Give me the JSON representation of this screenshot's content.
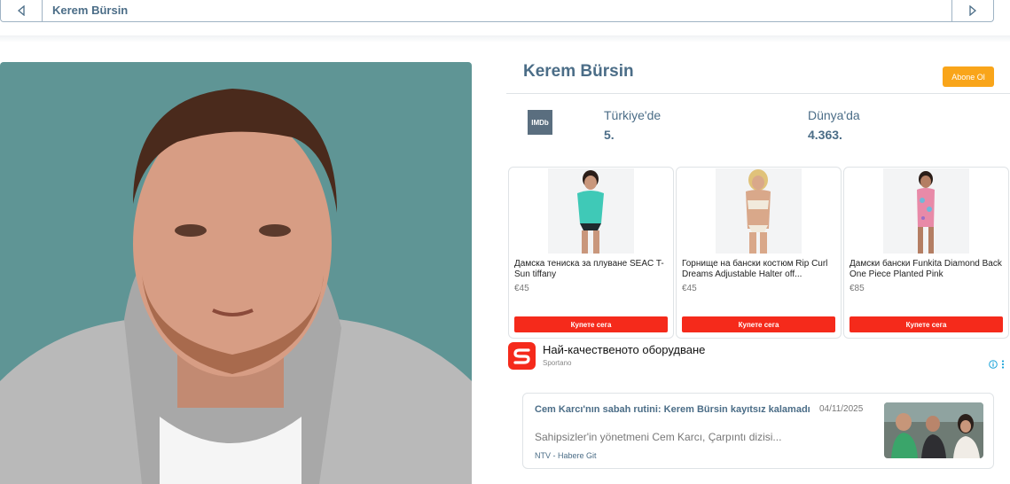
{
  "topbar": {
    "title": "Kerem Bürsin"
  },
  "profile": {
    "name": "Kerem Bürsin",
    "subscribe_label": "Abone Ol"
  },
  "imdb": {
    "badge": "IMDb",
    "turkey_label": "Türkiye'de",
    "turkey_rank": "5.",
    "world_label": "Dünya'da",
    "world_rank": "4.363."
  },
  "products": [
    {
      "title": "Дамска тениска за плуване SEAC T-Sun tiffany",
      "price": "€45",
      "button": "Купете сега"
    },
    {
      "title": "Горнище на бански костюм Rip Curl Dreams Adjustable Halter off...",
      "price": "€45",
      "button": "Купете сега"
    },
    {
      "title": "Дамски бански Funkita Diamond Back One Piece Planted Pink",
      "price": "€85",
      "button": "Купете сега"
    }
  ],
  "ad": {
    "headline": "Най-качественото оборудване",
    "brand": "Sportano"
  },
  "news": {
    "title": "Cem Karcı'nın sabah rutini: Kerem Bürsin kayıtsız kalamadı",
    "date": "04/11/2025",
    "snippet": "Sahipsizler'in yönetmeni Cem Karcı, Çarpıntı dizisi...",
    "source": "NTV - Habere Git"
  },
  "colors": {
    "accent": "#4b6d87",
    "subscribe": "#f9a51a",
    "buy": "#f52a1b",
    "portrait_bg": "#5f9595"
  }
}
